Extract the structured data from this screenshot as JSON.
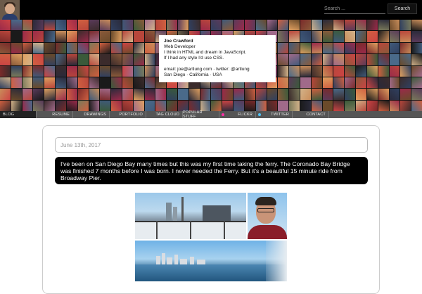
{
  "header": {
    "search_placeholder": "Search ...",
    "search_button": "Search"
  },
  "bio": {
    "name": "Joe Crawford",
    "title": "Web Developer",
    "line1": "I think in HTML and dream in JavaScript.",
    "line2": "If I had any style I'd use CSS.",
    "contact": "email: joe@artlung.com · twitter: @artlung",
    "location": "San Diego · California · USA"
  },
  "nav": {
    "items": [
      {
        "label": "Blog"
      },
      {
        "label": "Resume"
      },
      {
        "label": "Drawings"
      },
      {
        "label": "Portfolio"
      },
      {
        "label": "Tag Cloud"
      },
      {
        "label": "Popular Stuff"
      },
      {
        "label": "Flickr"
      },
      {
        "label": "Twitter"
      },
      {
        "label": "Contact"
      }
    ],
    "flickr_dot_color": "#ff2ea6",
    "twitter_dot_color": "#4fc3f7"
  },
  "post": {
    "date": "June 13th, 2017",
    "text": "I've been on San Diego Bay many times but this was my first time taking the ferry. The Coronado Bay Bridge was finished 7 months before I was born. I never needed the Ferry. But it's a beautiful 15 minute ride from Broadway Pier."
  },
  "colors": {
    "topbar": "#000000",
    "nav_bg": "#555555",
    "caption_bg": "#000000"
  }
}
